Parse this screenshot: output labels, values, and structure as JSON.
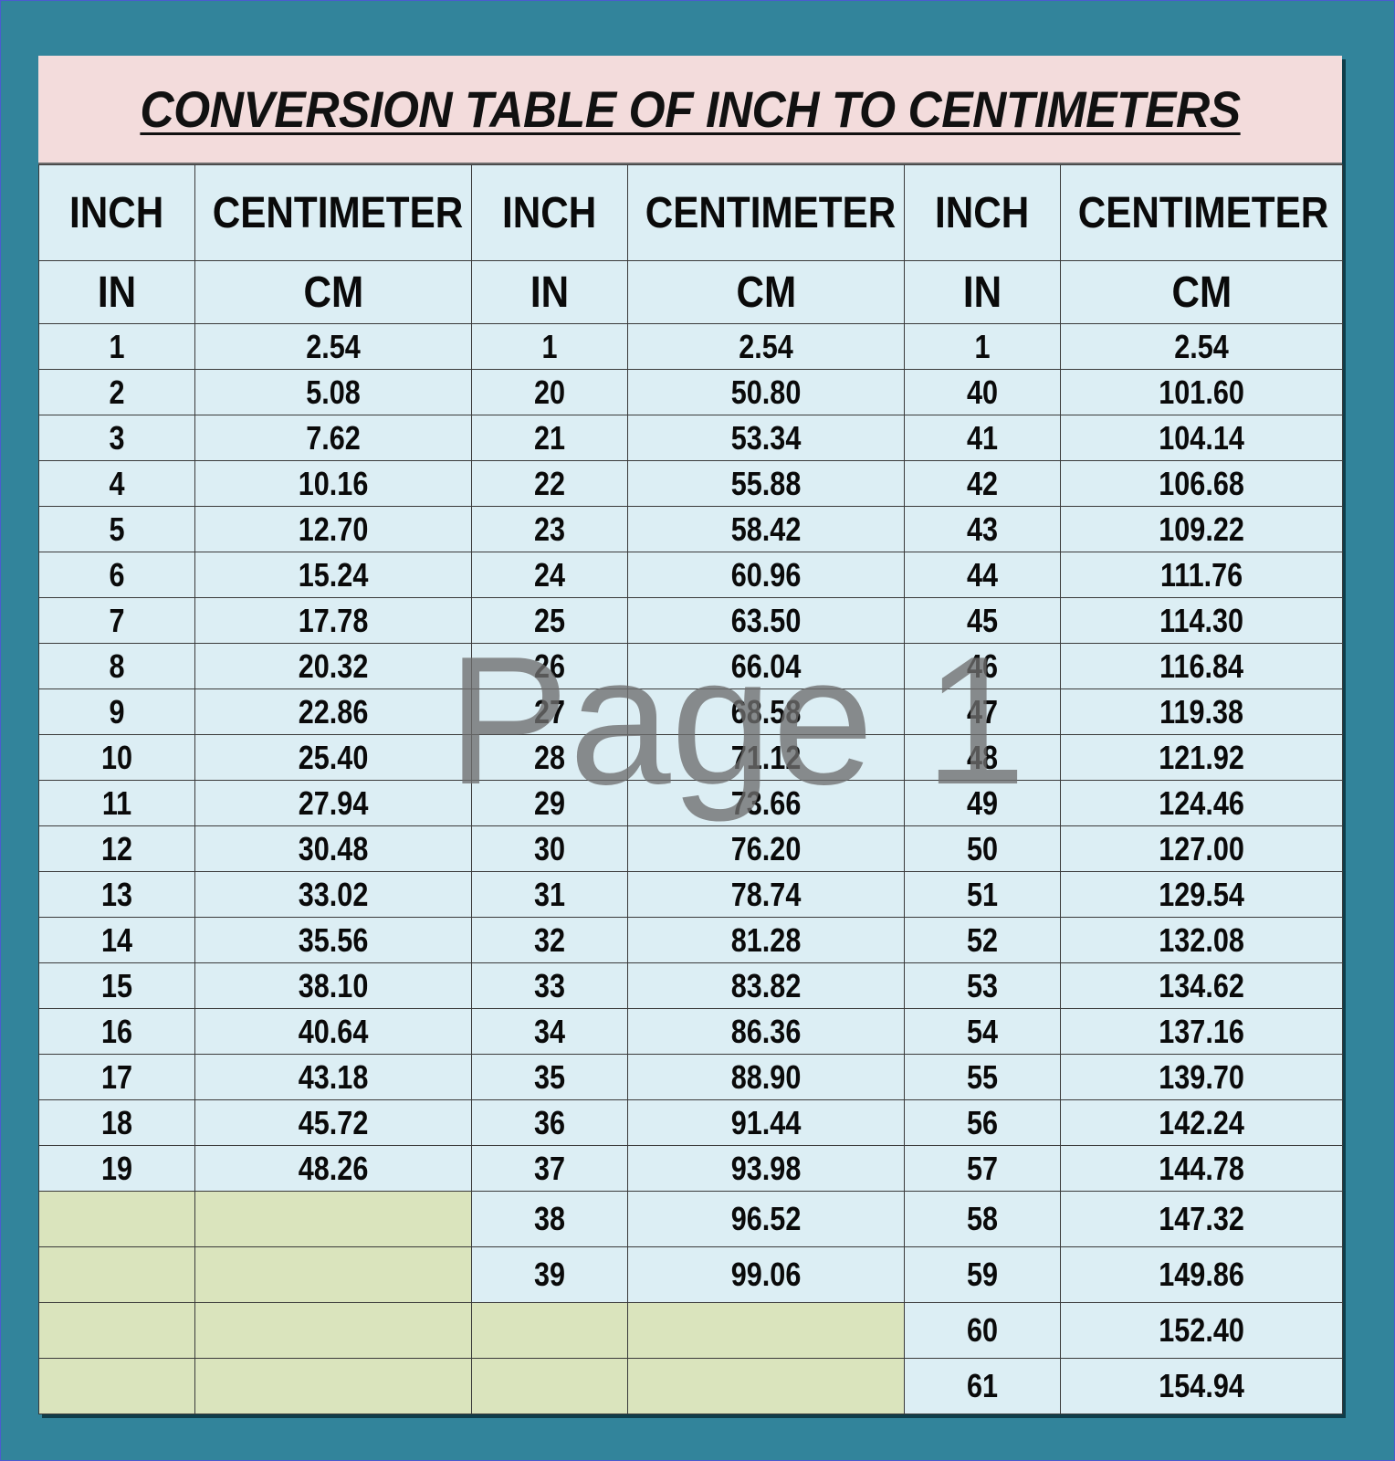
{
  "title": "CONVERSION TABLE OF INCH TO CENTIMETERS",
  "watermark": "Page 1",
  "headers": {
    "row1": [
      "INCH",
      "CENTIMETER",
      "INCH",
      "CENTIMETER",
      "INCH",
      "CENTIMETER"
    ],
    "row2": [
      "IN",
      "CM",
      "IN",
      "CM",
      "IN",
      "CM"
    ]
  },
  "colors": {
    "frame": "#32849b",
    "title_band": "#f3dcdc",
    "cell": "#dceef4",
    "empty_cell": "#dae4bd"
  },
  "rows": [
    [
      "1",
      "2.54",
      "1",
      "2.54",
      "1",
      "2.54"
    ],
    [
      "2",
      "5.08",
      "20",
      "50.80",
      "40",
      "101.60"
    ],
    [
      "3",
      "7.62",
      "21",
      "53.34",
      "41",
      "104.14"
    ],
    [
      "4",
      "10.16",
      "22",
      "55.88",
      "42",
      "106.68"
    ],
    [
      "5",
      "12.70",
      "23",
      "58.42",
      "43",
      "109.22"
    ],
    [
      "6",
      "15.24",
      "24",
      "60.96",
      "44",
      "111.76"
    ],
    [
      "7",
      "17.78",
      "25",
      "63.50",
      "45",
      "114.30"
    ],
    [
      "8",
      "20.32",
      "26",
      "66.04",
      "46",
      "116.84"
    ],
    [
      "9",
      "22.86",
      "27",
      "68.58",
      "47",
      "119.38"
    ],
    [
      "10",
      "25.40",
      "28",
      "71.12",
      "48",
      "121.92"
    ],
    [
      "11",
      "27.94",
      "29",
      "73.66",
      "49",
      "124.46"
    ],
    [
      "12",
      "30.48",
      "30",
      "76.20",
      "50",
      "127.00"
    ],
    [
      "13",
      "33.02",
      "31",
      "78.74",
      "51",
      "129.54"
    ],
    [
      "14",
      "35.56",
      "32",
      "81.28",
      "52",
      "132.08"
    ],
    [
      "15",
      "38.10",
      "33",
      "83.82",
      "53",
      "134.62"
    ],
    [
      "16",
      "40.64",
      "34",
      "86.36",
      "54",
      "137.16"
    ],
    [
      "17",
      "43.18",
      "35",
      "88.90",
      "55",
      "139.70"
    ],
    [
      "18",
      "45.72",
      "36",
      "91.44",
      "56",
      "142.24"
    ],
    [
      "19",
      "48.26",
      "37",
      "93.98",
      "57",
      "144.78"
    ],
    [
      "",
      "",
      "38",
      "96.52",
      "58",
      "147.32"
    ],
    [
      "",
      "",
      "39",
      "99.06",
      "59",
      "149.86"
    ],
    [
      "",
      "",
      "",
      "",
      "60",
      "152.40"
    ],
    [
      "",
      "",
      "",
      "",
      "61",
      "154.94"
    ]
  ]
}
